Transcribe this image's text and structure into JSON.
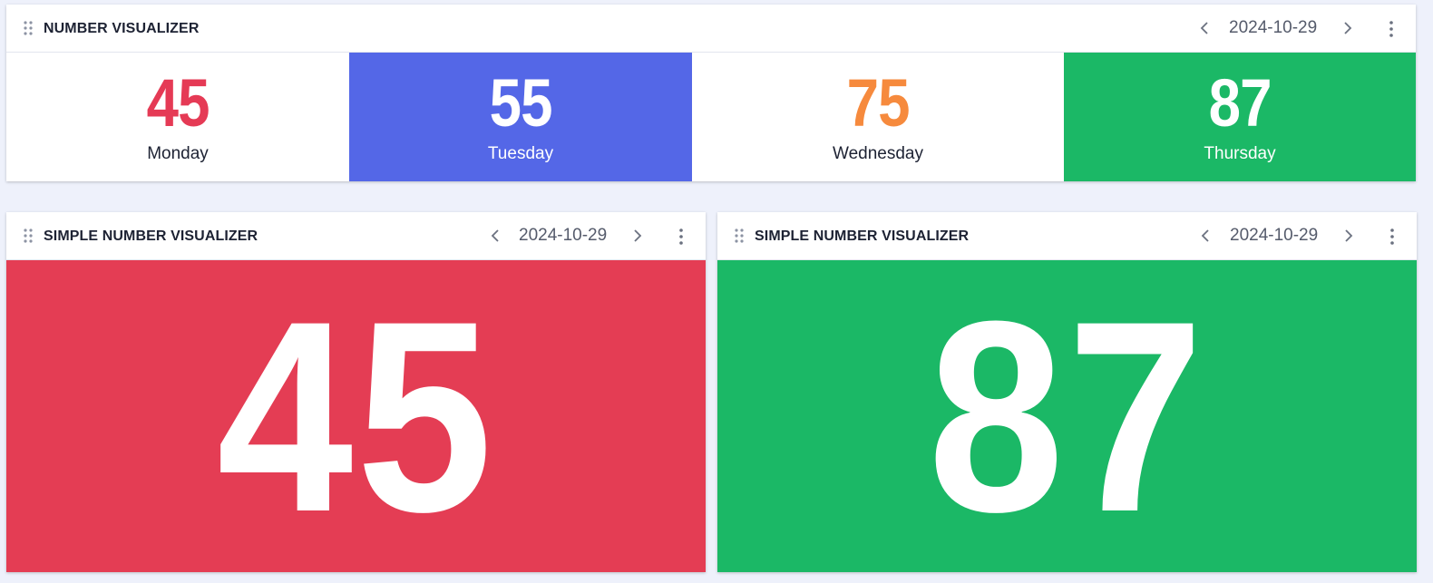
{
  "panels": {
    "number_visualizer": {
      "title": "NUMBER VISUALIZER",
      "date": "2024-10-29",
      "items": [
        {
          "value": "45",
          "label": "Monday",
          "bg": "#ffffff",
          "color": "#e53a55",
          "label_color": "#1d2233"
        },
        {
          "value": "55",
          "label": "Tuesday",
          "bg": "#5467e7",
          "color": "#ffffff",
          "label_color": "#ffffff"
        },
        {
          "value": "75",
          "label": "Wednesday",
          "bg": "#ffffff",
          "color": "#f68a3d",
          "label_color": "#1d2233"
        },
        {
          "value": "87",
          "label": "Thursday",
          "bg": "#1bb866",
          "color": "#ffffff",
          "label_color": "#ffffff"
        }
      ]
    },
    "simple_left": {
      "title": "SIMPLE NUMBER VISUALIZER",
      "date": "2024-10-29",
      "value": "45",
      "bg": "#e43d54"
    },
    "simple_right": {
      "title": "SIMPLE NUMBER VISUALIZER",
      "date": "2024-10-29",
      "value": "87",
      "bg": "#1bb866"
    }
  },
  "icons": {
    "drag": "drag-handle-icon",
    "prev": "chevron-left-icon",
    "next": "chevron-right-icon",
    "more": "more-vertical-icon"
  }
}
